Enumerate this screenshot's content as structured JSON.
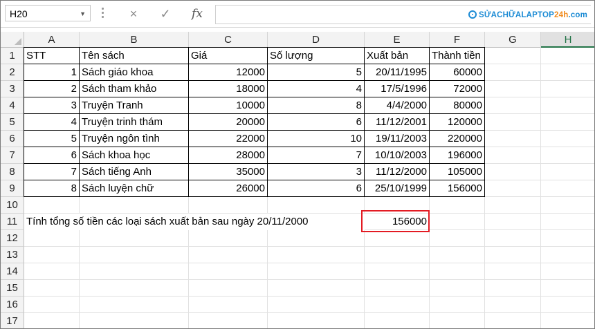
{
  "formula_bar": {
    "name_box": "H20",
    "cancel_icon": "×",
    "enter_icon": "✓",
    "fx_label": "fx",
    "formula": ""
  },
  "logo": {
    "main": "SỬACHỮALAPTOP",
    "accent": "24h",
    "suffix": ".com"
  },
  "columns": [
    "A",
    "B",
    "C",
    "D",
    "E",
    "F",
    "G",
    "H"
  ],
  "selected_column": "H",
  "row_numbers": [
    "1",
    "2",
    "3",
    "4",
    "5",
    "6",
    "7",
    "8",
    "9",
    "10",
    "11",
    "12",
    "13",
    "14",
    "15",
    "16",
    "17"
  ],
  "table": {
    "headers": [
      "STT",
      "Tên sách",
      "Giá",
      "Số lượng",
      "Xuất bản",
      "Thành tiền"
    ],
    "rows": [
      [
        "1",
        "Sách giáo khoa",
        "12000",
        "5",
        "20/11/1995",
        "60000"
      ],
      [
        "2",
        "Sách tham khảo",
        "18000",
        "4",
        "17/5/1996",
        "72000"
      ],
      [
        "3",
        "Truyện Tranh",
        "10000",
        "8",
        "4/4/2000",
        "80000"
      ],
      [
        "4",
        "Truyện trinh thám",
        "20000",
        "6",
        "11/12/2001",
        "120000"
      ],
      [
        "5",
        "Truyện ngôn tình",
        "22000",
        "10",
        "19/11/2003",
        "220000"
      ],
      [
        "6",
        "Sách khoa học",
        "28000",
        "7",
        "10/10/2003",
        "196000"
      ],
      [
        "7",
        "Sách tiếng Anh",
        "35000",
        "3",
        "11/12/2000",
        "105000"
      ],
      [
        "8",
        "Sách luyện chữ",
        "26000",
        "6",
        "25/10/1999",
        "156000"
      ]
    ]
  },
  "summary": {
    "label": "Tính tổng số tiền các loại sách xuất bản sau ngày 20/11/2000",
    "value": "156000",
    "highlight_color": "#e31b23"
  },
  "colors": {
    "accent": "#217346",
    "logo_blue": "#1a8ad4",
    "logo_orange": "#f08a1c"
  }
}
